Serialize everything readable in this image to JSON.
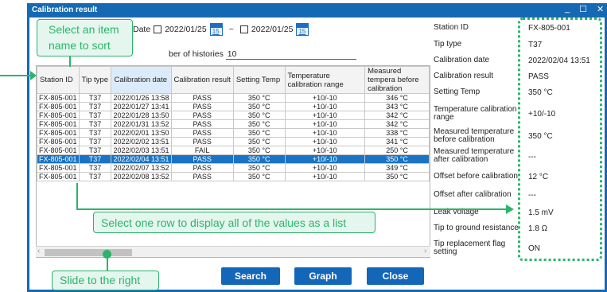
{
  "window": {
    "title": "Calibration result",
    "controls": [
      "_",
      "☐",
      "✕"
    ]
  },
  "filter": {
    "date_label": "Date",
    "from": "2022/01/25",
    "to": "2022/01/25",
    "separator": "~",
    "calendar_day": "15",
    "histories_label": "ber of histories",
    "histories_value": "10"
  },
  "table": {
    "headers": [
      "Station ID",
      "Tip type",
      "Calibration date",
      "Calibration result",
      "Setting Temp",
      "Temperature calibration range",
      "Measured tempera before calibration"
    ],
    "rows": [
      [
        "FX-805-001",
        "T37",
        "2022/01/26 13:58",
        "PASS",
        "350 °C",
        "+10/-10",
        "346 °C"
      ],
      [
        "FX-805-001",
        "T37",
        "2022/01/27 13:41",
        "PASS",
        "350 °C",
        "+10/-10",
        "343 °C"
      ],
      [
        "FX-805-001",
        "T37",
        "2022/01/28 13:50",
        "PASS",
        "350 °C",
        "+10/-10",
        "342 °C"
      ],
      [
        "FX-805-001",
        "T37",
        "2022/01/31 13:52",
        "PASS",
        "350 °C",
        "+10/-10",
        "342 °C"
      ],
      [
        "FX-805-001",
        "T37",
        "2022/02/01 13:50",
        "PASS",
        "350 °C",
        "+10/-10",
        "338 °C"
      ],
      [
        "FX-805-001",
        "T37",
        "2022/02/02 13:51",
        "PASS",
        "350 °C",
        "+10/-10",
        "341 °C"
      ],
      [
        "FX-805-001",
        "T37",
        "2022/02/03 13:51",
        "FAIL",
        "350 °C",
        "+10/-10",
        "250 °C"
      ],
      [
        "FX-805-001",
        "T37",
        "2022/02/04 13:51",
        "PASS",
        "350 °C",
        "+10/-10",
        "350 °C"
      ],
      [
        "FX-805-001",
        "T37",
        "2022/02/07 13:52",
        "PASS",
        "350 °C",
        "+10/-10",
        "349 °C"
      ],
      [
        "FX-805-001",
        "T37",
        "2022/02/08 13:52",
        "PASS",
        "350 °C",
        "+10/-10",
        "350 °C"
      ]
    ],
    "selected_row": 7
  },
  "details": [
    {
      "label": "Station ID",
      "value": "FX-805-001"
    },
    {
      "label": "Tip type",
      "value": "T37"
    },
    {
      "label": "Calibration date",
      "value": "2022/02/04 13:51"
    },
    {
      "label": "Calibration result",
      "value": "PASS"
    },
    {
      "label": "Setting Temp",
      "value": "350 °C"
    },
    {
      "label": "Temperature calibration range",
      "value": "+10/-10"
    },
    {
      "label": "Measured temperature before calibration",
      "value": "350 °C"
    },
    {
      "label": "Measured temperature after calibration",
      "value": "---"
    },
    {
      "label": "Offset before calibration",
      "value": "12 °C"
    },
    {
      "label": "Offset after calibration",
      "value": "---"
    },
    {
      "label": "Leak voltage",
      "value": "1.5 mV"
    },
    {
      "label": "Tip to ground resistance",
      "value": "1.8 Ω"
    },
    {
      "label": "Tip replacement flag setting",
      "value": "ON"
    }
  ],
  "buttons": {
    "search": "Search",
    "graph": "Graph",
    "close": "Close"
  },
  "callouts": {
    "sort": "Select an item name to sort",
    "row": "Select one row to display all of the values as a list",
    "slide": "Slide to the right"
  },
  "colors": {
    "titlebar": "#1569b3",
    "selected_row": "#1a73c5",
    "annotation": "#2ab56a",
    "button": "#1466b8"
  }
}
